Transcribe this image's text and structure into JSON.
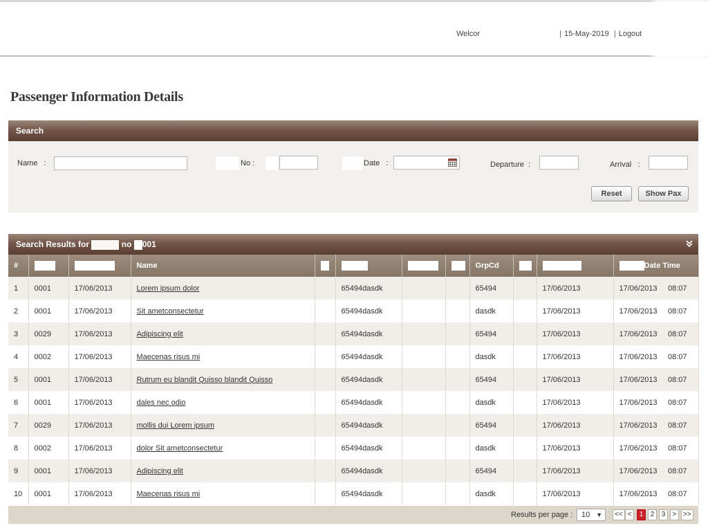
{
  "header": {
    "welcome_prefix": "Welcor",
    "date": "15-May-2019",
    "logout_label": "Logout"
  },
  "page_title": "Passenger Information Details",
  "search": {
    "panel_title": "Search",
    "name_label": "Name   :",
    "no_label": "No :",
    "date_label": "Date   :",
    "departure_label": "Departure  :",
    "arrival_label": "Arrival   :",
    "reset_label": "Reset",
    "show_pax_label": "Show Pax"
  },
  "results": {
    "panel_title_prefix": "Search Results for",
    "panel_title_mid": "no",
    "panel_title_suffix": "001",
    "columns": {
      "index": "#",
      "name": "Name",
      "grpcd": "GrpCd",
      "datetime": "Date Time"
    },
    "rows": [
      {
        "n": "1",
        "code": "0001",
        "date": "17/06/2013",
        "name": "Lorem ipsum dolor",
        "ref": "65494dasdk",
        "grp": "65494",
        "date2": "17/06/2013",
        "dt": "17/06/2013",
        "time": "08:07"
      },
      {
        "n": "2",
        "code": "0001",
        "date": "17/06/2013",
        "name": "Sit ametconsectetur",
        "ref": "65494dasdk",
        "grp": "dasdk",
        "date2": "17/06/2013",
        "dt": "17/06/2013",
        "time": "08:07"
      },
      {
        "n": "3",
        "code": "0029",
        "date": "17/06/2013",
        "name": "Adipiscing elit",
        "ref": "65494dasdk",
        "grp": "65494",
        "date2": "17/06/2013",
        "dt": "17/06/2013",
        "time": "08:07"
      },
      {
        "n": "4",
        "code": "0002",
        "date": "17/06/2013",
        "name": "Maecenas risus mi",
        "ref": "65494dasdk",
        "grp": "dasdk",
        "date2": "17/06/2013",
        "dt": "17/06/2013",
        "time": "08:07"
      },
      {
        "n": "5",
        "code": "0001",
        "date": "17/06/2013",
        "name": "Rutrum eu blandit Quisso blandit Quisso",
        "ref": "65494dasdk",
        "grp": "65494",
        "date2": "17/06/2013",
        "dt": "17/06/2013",
        "time": "08:07"
      },
      {
        "n": "6",
        "code": "0001",
        "date": "17/06/2013",
        "name": "dales nec odio",
        "ref": "65494dasdk",
        "grp": "dasdk",
        "date2": "17/06/2013",
        "dt": "17/06/2013",
        "time": "08:07"
      },
      {
        "n": "7",
        "code": "0029",
        "date": "17/06/2013",
        "name": "mollis dui Lorem ipsum",
        "ref": "65494dasdk",
        "grp": "65494",
        "date2": "17/06/2013",
        "dt": "17/06/2013",
        "time": "08:07"
      },
      {
        "n": "8",
        "code": "0002",
        "date": "17/06/2013",
        "name": "dolor Sit ametconsectetur",
        "ref": "65494dasdk",
        "grp": "dasdk",
        "date2": "17/06/2013",
        "dt": "17/06/2013",
        "time": "08:07"
      },
      {
        "n": "9",
        "code": "0001",
        "date": "17/06/2013",
        "name": "Adipiscing elit",
        "ref": "65494dasdk",
        "grp": "65494",
        "date2": "17/06/2013",
        "dt": "17/06/2013",
        "time": "08:07"
      },
      {
        "n": "10",
        "code": "0001",
        "date": "17/06/2013",
        "name": "Maecenas risus mi",
        "ref": "65494dasdk",
        "grp": "dasdk",
        "date2": "17/06/2013",
        "dt": "17/06/2013",
        "time": "08:07"
      }
    ]
  },
  "pager": {
    "rpp_label": "Results per page :",
    "rpp_value": "10",
    "first": "<<",
    "prev": "<",
    "pages": [
      "1",
      "2",
      "3"
    ],
    "next": ">",
    "last": ">>"
  },
  "colors": {
    "panel_header": "#5c3f33",
    "table_header": "#857565",
    "active_page": "#cc1f27"
  }
}
